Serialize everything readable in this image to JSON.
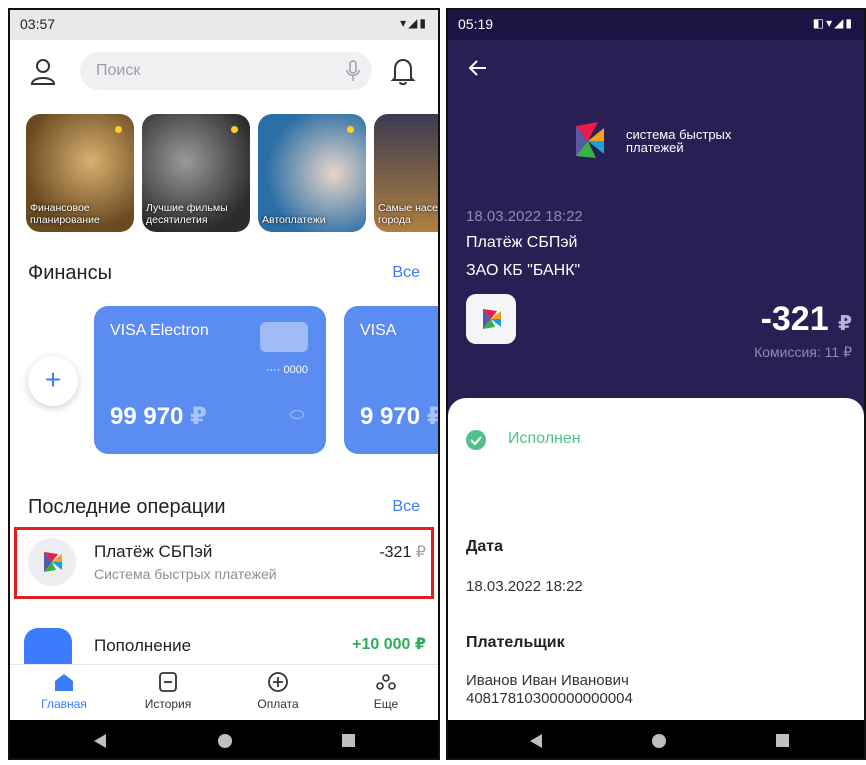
{
  "left": {
    "status": {
      "time": "03:57"
    },
    "search": {
      "placeholder": "Поиск"
    },
    "stories": [
      {
        "label": "Финансовое планирование",
        "bg": "#6a4a20"
      },
      {
        "label": "Лучшие фильмы десятилетия",
        "bg": "#3c3c3c"
      },
      {
        "label": "Автоплатежи",
        "bg": "#2c6fa6"
      },
      {
        "label": "Самые населенные города",
        "bg": "#6a5a3a"
      }
    ],
    "finance": {
      "title": "Финансы",
      "all_link": "Все"
    },
    "cards": [
      {
        "title": "VISA Electron",
        "number": "···· 0000",
        "amount": "99 970",
        "currency": "₽"
      },
      {
        "title": "VISA",
        "amount": "9 970",
        "currency": "₽"
      }
    ],
    "ops": {
      "title": "Последние операции",
      "all_link": "Все",
      "items": [
        {
          "title": "Платёж СБПэй",
          "subtitle": "Система быстрых платежей",
          "amount": "-321",
          "currency": "₽"
        },
        {
          "title": "Пополнение",
          "amount": "+10 000",
          "currency": "₽"
        }
      ]
    },
    "nav": [
      {
        "label": "Главная",
        "icon": "home-icon"
      },
      {
        "label": "История",
        "icon": "history-icon"
      },
      {
        "label": "Оплата",
        "icon": "payment-plus-icon"
      },
      {
        "label": "Еще",
        "icon": "more-icon"
      }
    ],
    "colors": {
      "accent": "#3b7bff",
      "card": "#5a8cf2",
      "positive": "#2fae5a",
      "highlight": "#e02020"
    }
  },
  "right": {
    "status": {
      "time": "05:19"
    },
    "sbp_text": {
      "line1": "система быстрых",
      "line2": "платежей"
    },
    "datetime": "18.03.2022 18:22",
    "payment_name": "Платёж СБПэй",
    "bank": "ЗАО КБ \"БАНК\"",
    "amount": "-321",
    "currency": "₽",
    "fee": "Комиссия: 11 ₽",
    "status_text": "Исполнен",
    "date_label": "Дата",
    "date_value": "18.03.2022 18:22",
    "payer_label": "Плательщик",
    "payer_name": "Иванов Иван Иванович",
    "payer_account": "40817810300000000004",
    "colors": {
      "header": "#2a1f55",
      "success": "#4fc28b"
    }
  }
}
